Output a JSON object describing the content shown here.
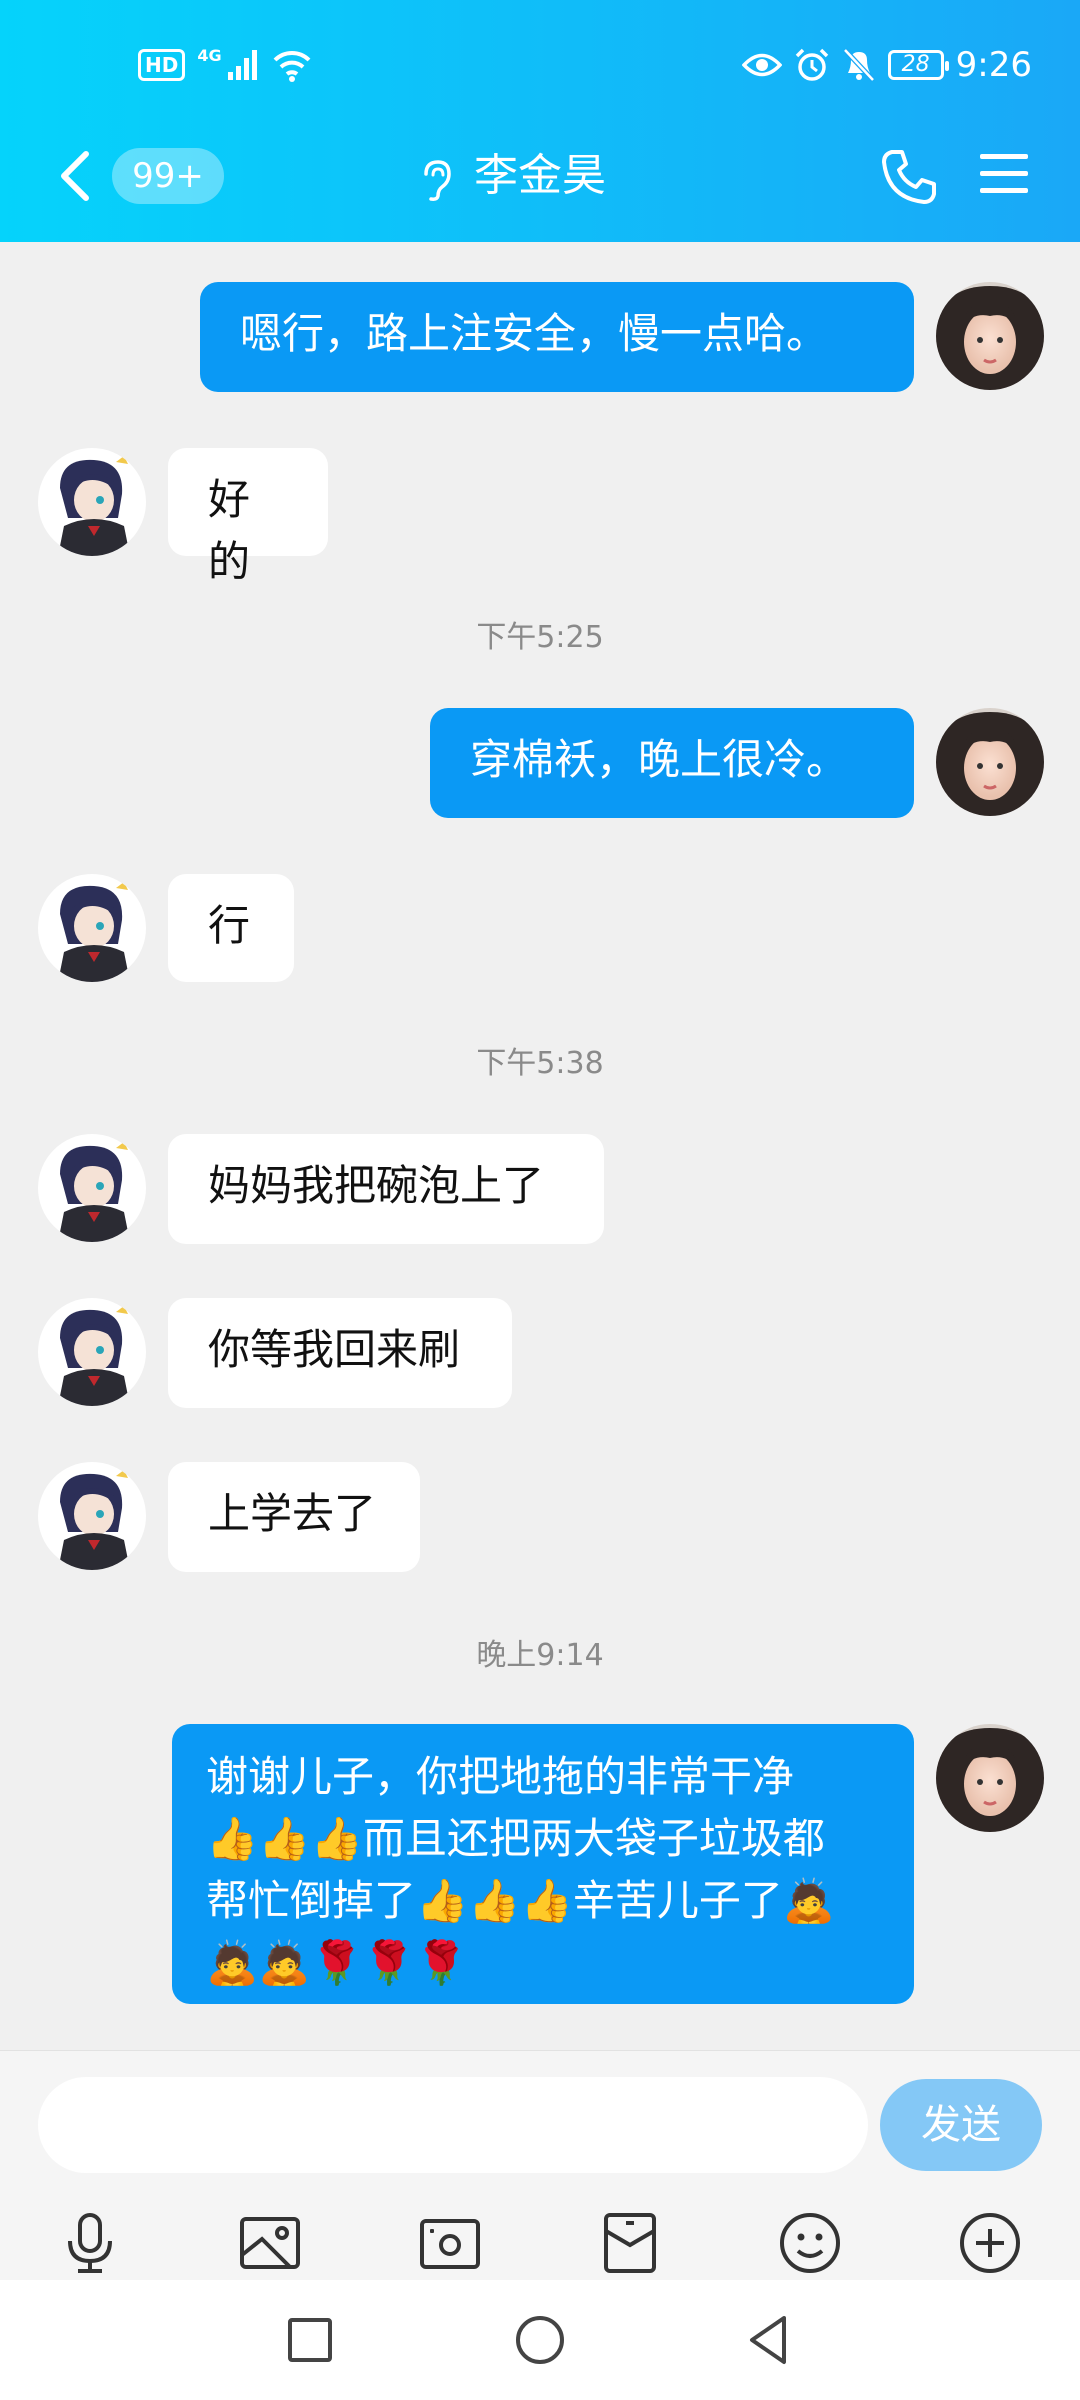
{
  "status_bar": {
    "hd": "HD",
    "network": "4G",
    "battery": "28",
    "time": "9:26"
  },
  "header": {
    "unread_badge": "99+",
    "title": "李金昊"
  },
  "messages": [
    {
      "text": "嗯行，路上注安全，慢一点哈。"
    },
    {
      "text": "好的"
    },
    {
      "text": "穿棉袄，晚上很冷。"
    },
    {
      "text": "行"
    },
    {
      "text": "妈妈我把碗泡上了"
    },
    {
      "text": "你等我回来刷"
    },
    {
      "text": "上学去了"
    },
    {
      "text": "谢谢儿子，你把地拖的非常干净\n👍👍👍而且还把两大袋子垃圾都\n帮忙倒掉了👍👍👍辛苦儿子了🙇\n🙇🙇🌹🌹🌹"
    }
  ],
  "timestamps": [
    "下午5:25",
    "下午5:38",
    "晚上9:14"
  ],
  "input": {
    "placeholder": "",
    "send_label": "发送"
  },
  "colors": {
    "header_start": "#05d3fb",
    "header_end": "#1aa8f7",
    "outgoing_bubble": "#0a99f5",
    "send_button": "#84c8f6"
  },
  "icons": {
    "toolbar": [
      "microphone-icon",
      "image-icon",
      "camera-icon",
      "red-packet-icon",
      "emoji-icon",
      "plus-icon"
    ],
    "system_nav": [
      "recent-apps-icon",
      "home-icon",
      "back-icon"
    ]
  }
}
